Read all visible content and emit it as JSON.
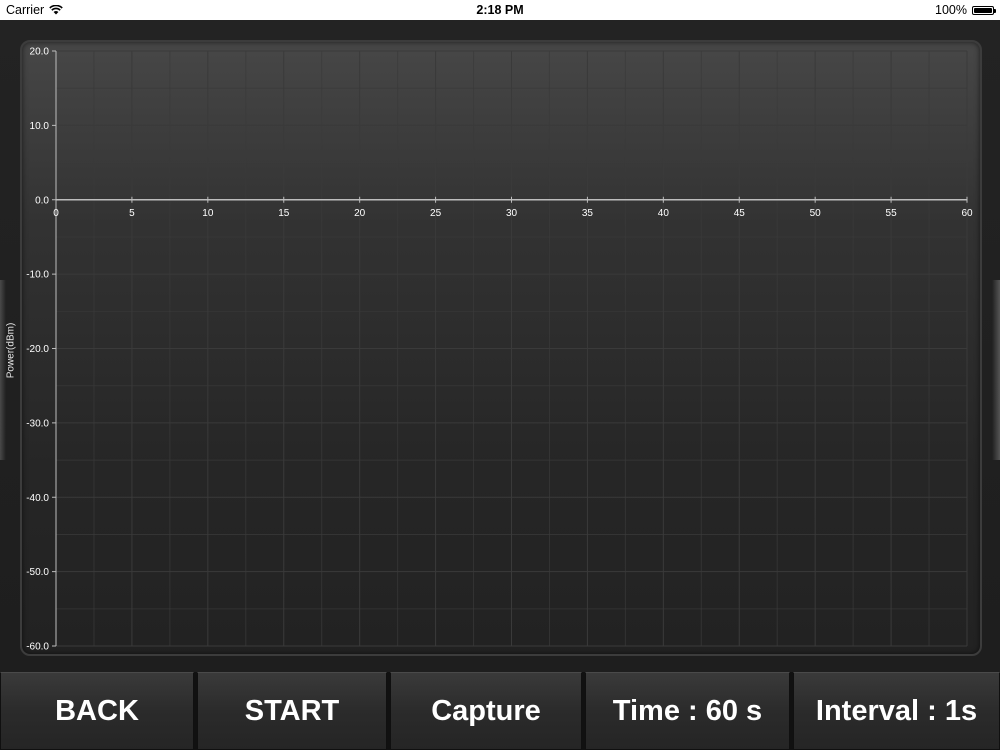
{
  "status_bar": {
    "carrier": "Carrier",
    "time": "2:18 PM",
    "battery": "100%",
    "battery_level": 1.0,
    "wifi_icon": "wifi-icon",
    "battery_icon": "battery-icon"
  },
  "toolbar": {
    "back_label": "BACK",
    "start_label": "START",
    "capture_label": "Capture",
    "time_label": "Time : 60 s",
    "interval_label": "Interval : 1s"
  },
  "chart_data": {
    "type": "line",
    "title": "",
    "xlabel": "",
    "ylabel": "Power(dBm)",
    "xlim": [
      0,
      60
    ],
    "ylim": [
      -60,
      20
    ],
    "x_ticks": [
      0,
      5,
      10,
      15,
      20,
      25,
      30,
      35,
      40,
      45,
      50,
      55,
      60
    ],
    "x_tick_labels": [
      "0",
      "5",
      "10",
      "15",
      "20",
      "25",
      "30",
      "35",
      "40",
      "45",
      "50",
      "55",
      "60"
    ],
    "y_ticks": [
      20,
      10,
      0,
      -10,
      -20,
      -30,
      -40,
      -50,
      -60
    ],
    "y_tick_labels": [
      "20.0",
      "10.0",
      "0.0",
      "-10.0",
      "-20.0",
      "-30.0",
      "-40.0",
      "-50.0",
      "-60.0"
    ],
    "grid": true,
    "x_axis_at_y": 0,
    "series": [
      {
        "values": []
      }
    ],
    "colors": {
      "axis": "#bdbdbd",
      "grid": "#3a3a3a",
      "tick_text": "#ffffff"
    }
  }
}
